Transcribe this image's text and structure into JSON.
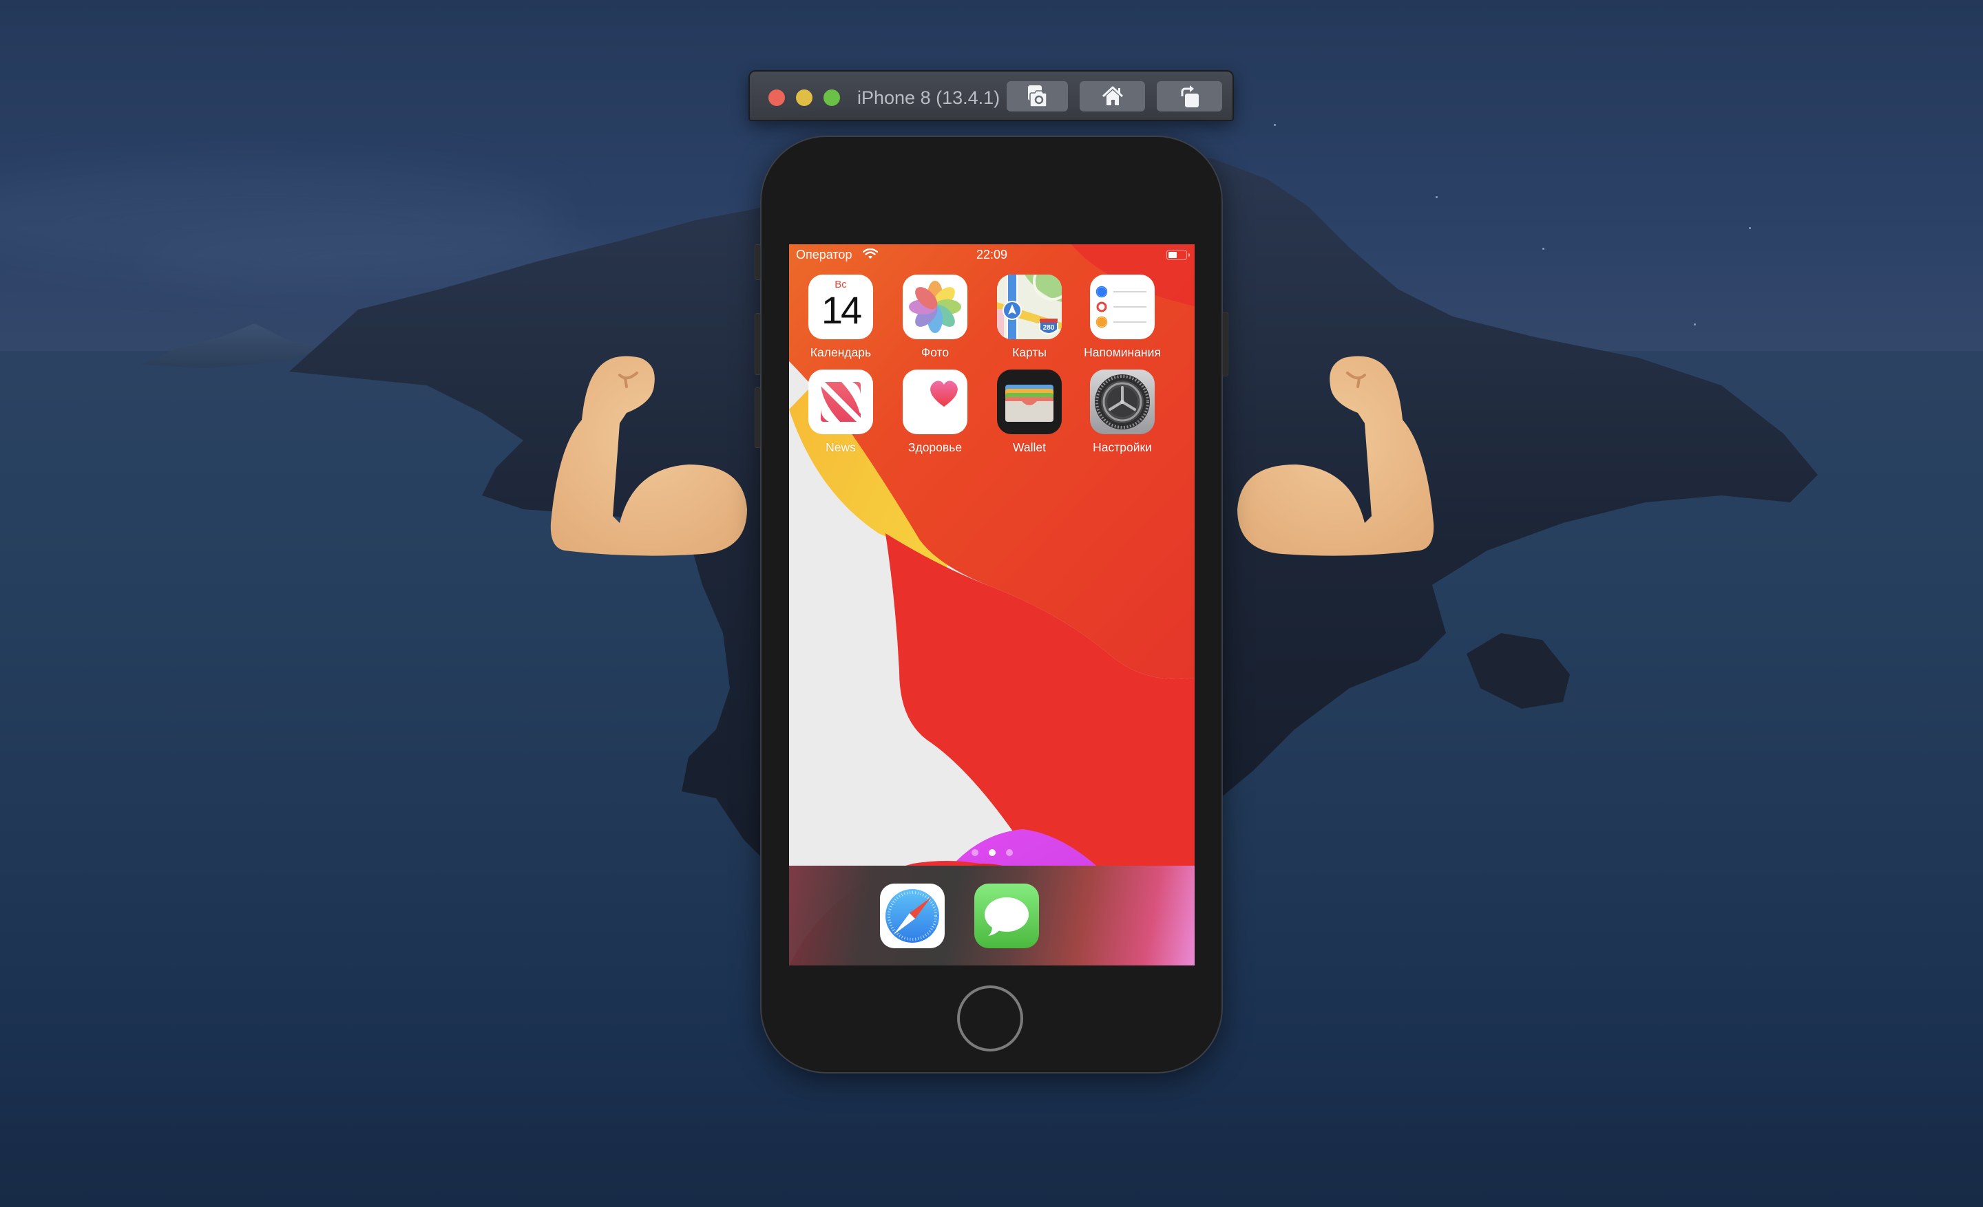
{
  "simulator": {
    "title": "iPhone 8 (13.4.1)",
    "buttons": [
      {
        "name": "screenshot",
        "icon": "camera-screenshot-icon"
      },
      {
        "name": "home",
        "icon": "home-icon"
      },
      {
        "name": "rotate",
        "icon": "rotate-icon"
      }
    ],
    "traffic_lights": {
      "close": "#ec6559",
      "minimize": "#e0bd44",
      "zoom": "#6bc046"
    }
  },
  "status_bar": {
    "carrier": "Оператор",
    "time": "22:09",
    "battery_level": 0.5
  },
  "home_screen": {
    "apps": [
      {
        "label": "Календарь",
        "icon": "calendar-icon",
        "day": "Вс",
        "date": "14"
      },
      {
        "label": "Фото",
        "icon": "photos-icon"
      },
      {
        "label": "Карты",
        "icon": "maps-icon",
        "route": "280"
      },
      {
        "label": "Напоминания",
        "icon": "reminders-icon"
      },
      {
        "label": "News",
        "icon": "news-icon"
      },
      {
        "label": "Здоровье",
        "icon": "health-icon"
      },
      {
        "label": "Wallet",
        "icon": "wallet-icon"
      },
      {
        "label": "Настройки",
        "icon": "settings-icon"
      }
    ],
    "pages": 3,
    "current_page": 2,
    "dock": [
      {
        "name": "Safari",
        "icon": "safari-icon"
      },
      {
        "name": "Messages",
        "icon": "messages-icon"
      }
    ]
  },
  "decorations": [
    "flexed-biceps-left",
    "flexed-biceps-right"
  ]
}
